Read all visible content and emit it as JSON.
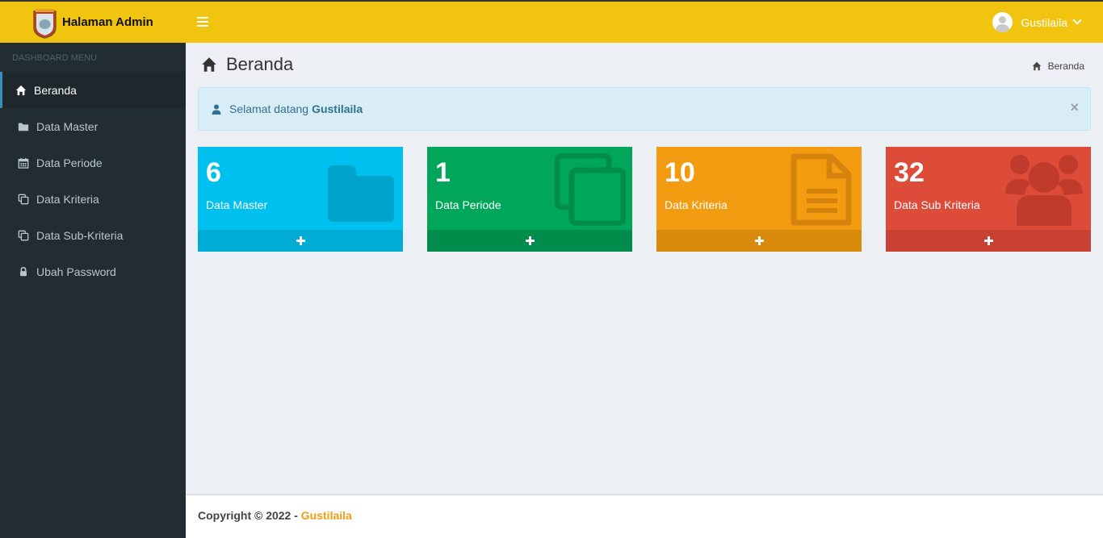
{
  "header": {
    "app_title": "Halaman Admin",
    "user_name": "Gustilaila",
    "brand_color": "#f1c40f"
  },
  "sidebar": {
    "section_label": "DASHBOARD MENU",
    "items": [
      {
        "label": "Beranda",
        "icon": "home-icon",
        "active": true
      },
      {
        "label": "Data Master",
        "icon": "folder-icon"
      },
      {
        "label": "Data Periode",
        "icon": "calendar-icon"
      },
      {
        "label": "Data Kriteria",
        "icon": "copy-icon"
      },
      {
        "label": "Data Sub-Kriteria",
        "icon": "copy-icon"
      },
      {
        "label": "Ubah Password",
        "icon": "lock-icon"
      }
    ]
  },
  "main": {
    "page_title": "Beranda",
    "breadcrumb": "Beranda",
    "alert": {
      "prefix": "Selamat datang",
      "name": "Gustilaila",
      "close": "×"
    },
    "boxes": [
      {
        "count": "6",
        "label": "Data Master",
        "icon": "folder-icon",
        "color": "#00c0ef"
      },
      {
        "count": "1",
        "label": "Data Periode",
        "icon": "copy-icon",
        "color": "#00a65a"
      },
      {
        "count": "10",
        "label": "Data Kriteria",
        "icon": "file-icon",
        "color": "#f39c12"
      },
      {
        "count": "32",
        "label": "Data Sub Kriteria",
        "icon": "users-icon",
        "color": "#dd4b39"
      }
    ]
  },
  "footer": {
    "copyright": "Copyright © 2022 -",
    "brand": "Gustilaila"
  }
}
